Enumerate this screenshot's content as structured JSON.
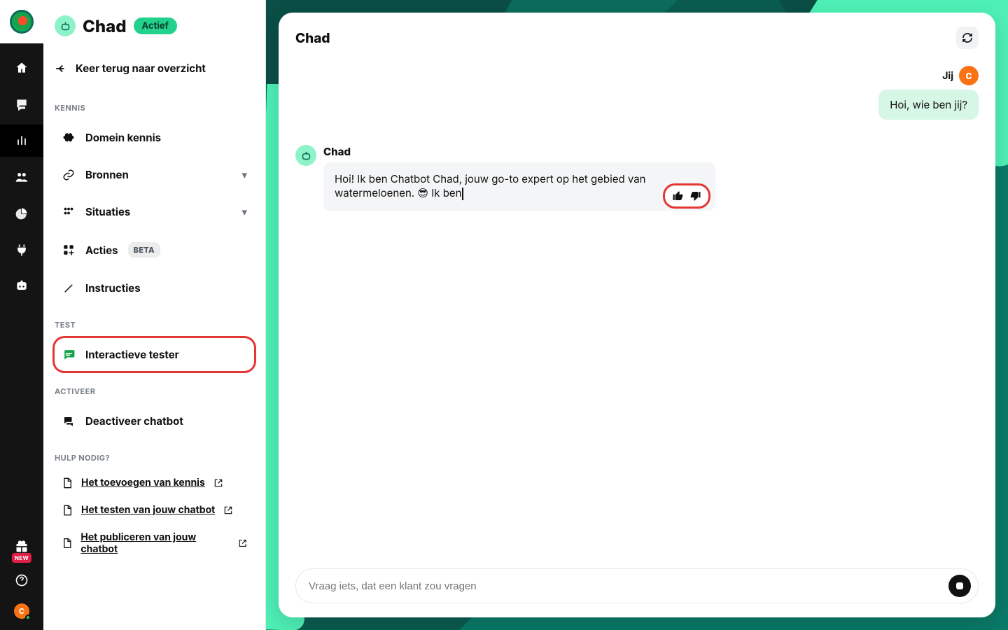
{
  "rail": {
    "gift_badge": "NEW",
    "avatar_initial": "C"
  },
  "sidebar": {
    "title": "Chad",
    "status": "Actief",
    "back": "Keer terug naar overzicht",
    "sections": {
      "knowledge": "KENNIS",
      "test": "TEST",
      "activate": "ACTIVEER",
      "help": "HULP NODIG?"
    },
    "items": {
      "domain": {
        "label": "Domein kennis"
      },
      "sources": {
        "label": "Bronnen"
      },
      "situations": {
        "label": "Situaties"
      },
      "actions": {
        "label": "Acties",
        "badge": "BETA"
      },
      "instructions": {
        "label": "Instructies"
      },
      "tester": {
        "label": "Interactieve tester"
      },
      "deactivate": {
        "label": "Deactiveer chatbot"
      }
    },
    "help": [
      {
        "label": "Het toevoegen van kennis"
      },
      {
        "label": "Het testen van jouw chatbot"
      },
      {
        "label": "Het publiceren van jouw chatbot"
      }
    ]
  },
  "chat": {
    "title": "Chad",
    "you_label": "Jij",
    "you_initial": "C",
    "user_message": "Hoi, wie ben jij?",
    "bot_name": "Chad",
    "bot_message": "Hoi!  Ik ben Chatbot Chad, jouw go-to expert op het gebied van watermeloenen. 😎 Ik ben",
    "placeholder": "Vraag iets, dat een klant zou vragen"
  }
}
